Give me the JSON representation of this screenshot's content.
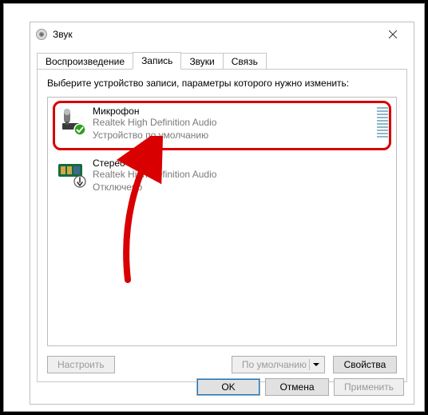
{
  "window": {
    "title": "Звук"
  },
  "tabs": {
    "playback": "Воспроизведение",
    "recording": "Запись",
    "sounds": "Звуки",
    "comm": "Связь"
  },
  "instruction": "Выберите устройство записи, параметры которого нужно изменить:",
  "devices": {
    "mic": {
      "title": "Микрофон",
      "driver": "Realtek High Definition Audio",
      "status": "Устройство по умолчанию"
    },
    "stereo": {
      "title": "Стерео микшер",
      "driver": "Realtek High Definition Audio",
      "status": "Отключено"
    }
  },
  "buttons": {
    "configure": "Настроить",
    "setdefault": "По умолчанию",
    "properties": "Свойства",
    "ok": "OK",
    "cancel": "Отмена",
    "apply": "Применить"
  },
  "colors": {
    "highlight": "#d80000",
    "accent": "#0078d7"
  }
}
